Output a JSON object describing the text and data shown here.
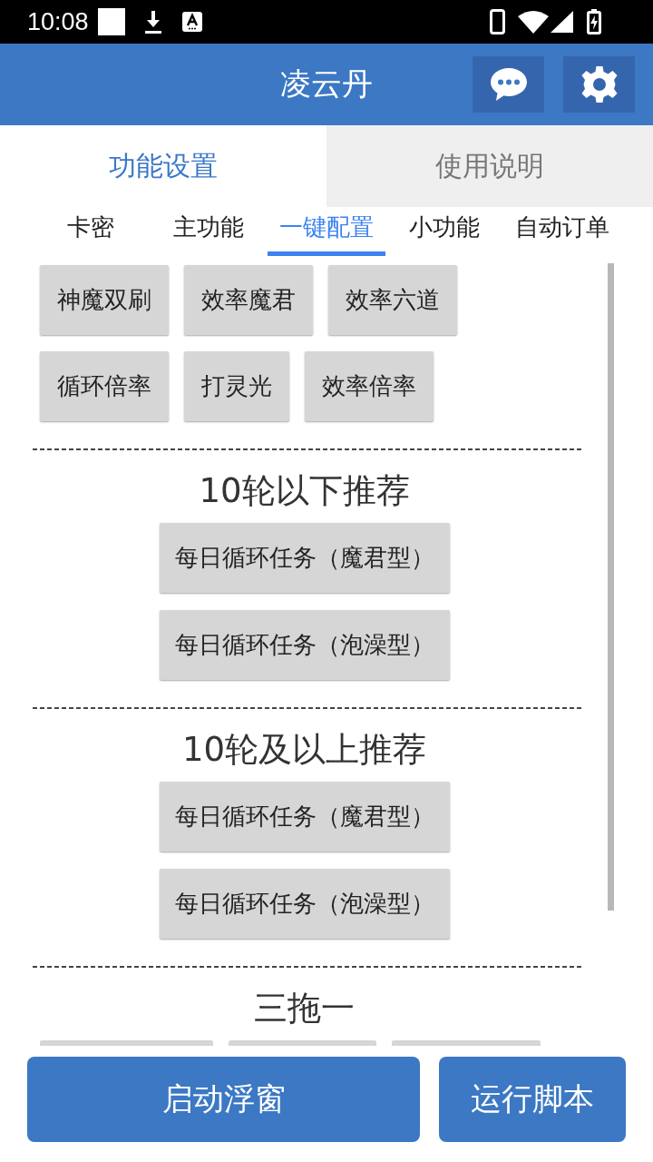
{
  "status_bar": {
    "time": "10:08"
  },
  "app_bar": {
    "title": "凌云丹"
  },
  "main_tabs": [
    {
      "label": "功能设置",
      "selected": true
    },
    {
      "label": "使用说明",
      "selected": false
    }
  ],
  "sub_tabs": [
    {
      "label": "卡密",
      "selected": false
    },
    {
      "label": "主功能",
      "selected": false
    },
    {
      "label": "一键配置",
      "selected": true
    },
    {
      "label": "小功能",
      "selected": false
    },
    {
      "label": "自动订单",
      "selected": false
    }
  ],
  "sections": [
    {
      "kind": "grid",
      "buttons": [
        "神魔双刷",
        "效率魔君",
        "效率六道",
        "循环倍率",
        "打灵光",
        "效率倍率"
      ]
    },
    {
      "kind": "stack",
      "title": "10轮以下推荐",
      "buttons": [
        "每日循环任务（魔君型）",
        "每日循环任务（泡澡型）"
      ]
    },
    {
      "kind": "stack",
      "title": "10轮及以上推荐",
      "buttons": [
        "每日循环任务（魔君型）",
        "每日循环任务（泡澡型）"
      ]
    },
    {
      "kind": "cut_off",
      "title": "三拖一",
      "partial_buttons": [
        {
          "kind": "cut_off"
        },
        {
          "kind": "cut_off"
        },
        {
          "kind": "cut_off"
        }
      ]
    }
  ],
  "bottom_buttons": [
    "启动浮窗",
    "运行脚本"
  ]
}
